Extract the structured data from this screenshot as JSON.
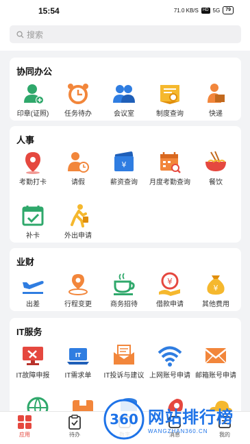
{
  "status_bar": {
    "time": "15:54",
    "speed": "71.0 KB/S",
    "network": "HD",
    "signal": "5G",
    "battery": "79"
  },
  "search": {
    "placeholder": "搜索"
  },
  "sections": [
    {
      "title": "协同办公",
      "items": [
        {
          "label": "印章(证照)",
          "icon": "seal-user-icon"
        },
        {
          "label": "任务待办",
          "icon": "alarm-clock-icon"
        },
        {
          "label": "会议室",
          "icon": "meeting-users-icon"
        },
        {
          "label": "制度查询",
          "icon": "document-search-icon"
        },
        {
          "label": "快递",
          "icon": "courier-icon"
        }
      ]
    },
    {
      "title": "人事",
      "items": [
        {
          "label": "考勤打卡",
          "icon": "location-pin-icon"
        },
        {
          "label": "请假",
          "icon": "leave-clock-icon"
        },
        {
          "label": "薪资查询",
          "icon": "salary-wallet-icon"
        },
        {
          "label": "月度考勤查询",
          "icon": "calendar-search-icon"
        },
        {
          "label": "餐饮",
          "icon": "noodle-bowl-icon"
        },
        {
          "label": "补卡",
          "icon": "calendar-check-icon"
        },
        {
          "label": "外出申请",
          "icon": "walking-person-icon"
        }
      ]
    },
    {
      "title": "业财",
      "items": [
        {
          "label": "出差",
          "icon": "airplane-icon"
        },
        {
          "label": "行程变更",
          "icon": "route-pin-icon"
        },
        {
          "label": "商务招待",
          "icon": "coffee-cup-icon"
        },
        {
          "label": "借款申请",
          "icon": "loan-hand-icon"
        },
        {
          "label": "其他费用",
          "icon": "money-bag-icon"
        }
      ]
    },
    {
      "title": "IT服务",
      "items": [
        {
          "label": "IT故障申报",
          "icon": "monitor-tools-icon"
        },
        {
          "label": "IT需求单",
          "icon": "it-laptop-icon"
        },
        {
          "label": "IT投诉与建议",
          "icon": "envelope-open-icon"
        },
        {
          "label": "上网账号申请",
          "icon": "wifi-icon"
        },
        {
          "label": "邮箱账号申请",
          "icon": "mail-icon"
        }
      ]
    }
  ],
  "tabbar": [
    {
      "label": "应用",
      "icon": "apps-grid-icon"
    },
    {
      "label": "待办",
      "icon": "todo-clipboard-icon"
    },
    {
      "label": "数字",
      "icon": "digital-icon"
    },
    {
      "label": "消息",
      "icon": "message-icon"
    },
    {
      "label": "我的",
      "icon": "profile-icon"
    }
  ],
  "watermark": {
    "logo_text": "360",
    "title": "网站排行榜",
    "subtitle": "WANGZHAN360.CN"
  },
  "colors": {
    "green": "#2fa86b",
    "orange": "#f2863b",
    "blue": "#2f7de1",
    "red": "#e5483f",
    "yellow": "#f5b82e"
  }
}
